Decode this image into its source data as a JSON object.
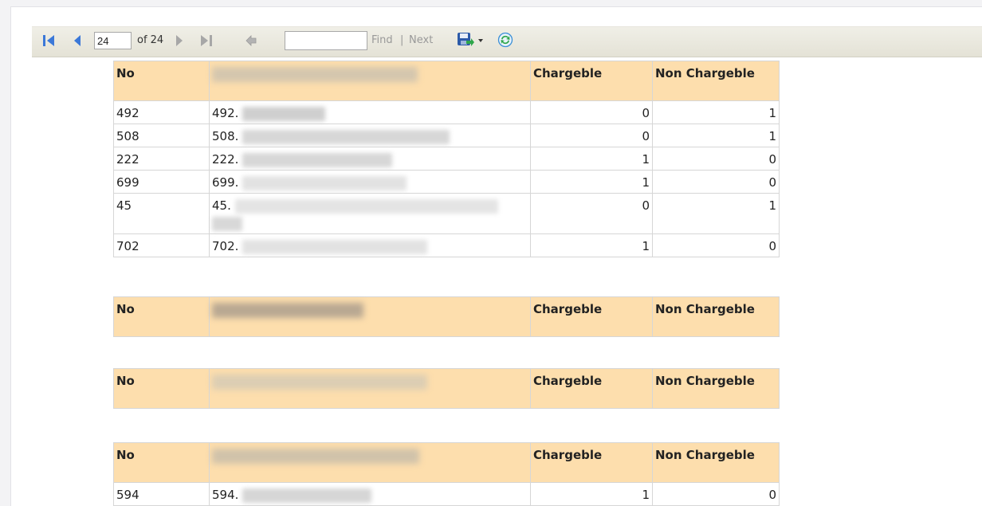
{
  "toolbar": {
    "page_current": "24",
    "page_of": "of 24",
    "find_label": "Find",
    "next_label": "Next",
    "find_value": "",
    "icons": [
      "first-page-icon",
      "previous-page-icon",
      "next-page-icon",
      "last-page-icon",
      "back-icon",
      "save-export-icon",
      "refresh-icon"
    ]
  },
  "headers": {
    "no": "No",
    "chargeable": "Chargeble",
    "non_chargeable": "Non Chargeble"
  },
  "groups": [
    {
      "rows": [
        {
          "no": "492",
          "name_prefix": "492.",
          "chargeable": "0",
          "non_chargeable": "1"
        },
        {
          "no": "508",
          "name_prefix": "508.",
          "chargeable": "0",
          "non_chargeable": "1"
        },
        {
          "no": "222",
          "name_prefix": "222.",
          "chargeable": "1",
          "non_chargeable": "0"
        },
        {
          "no": "699",
          "name_prefix": "699.",
          "chargeable": "1",
          "non_chargeable": "0"
        },
        {
          "no": "45",
          "name_prefix": "45.",
          "chargeable": "0",
          "non_chargeable": "1"
        },
        {
          "no": "702",
          "name_prefix": "702.",
          "chargeable": "1",
          "non_chargeable": "0"
        }
      ]
    },
    {
      "rows": []
    },
    {
      "rows": []
    },
    {
      "rows": [
        {
          "no": "594",
          "name_prefix": "594.",
          "chargeable": "1",
          "non_chargeable": "0"
        }
      ]
    }
  ],
  "colors": {
    "header_bg": "#fddead",
    "toolbar_bg": "#e9e7dd",
    "accent_icon": "#3b6fc9"
  }
}
